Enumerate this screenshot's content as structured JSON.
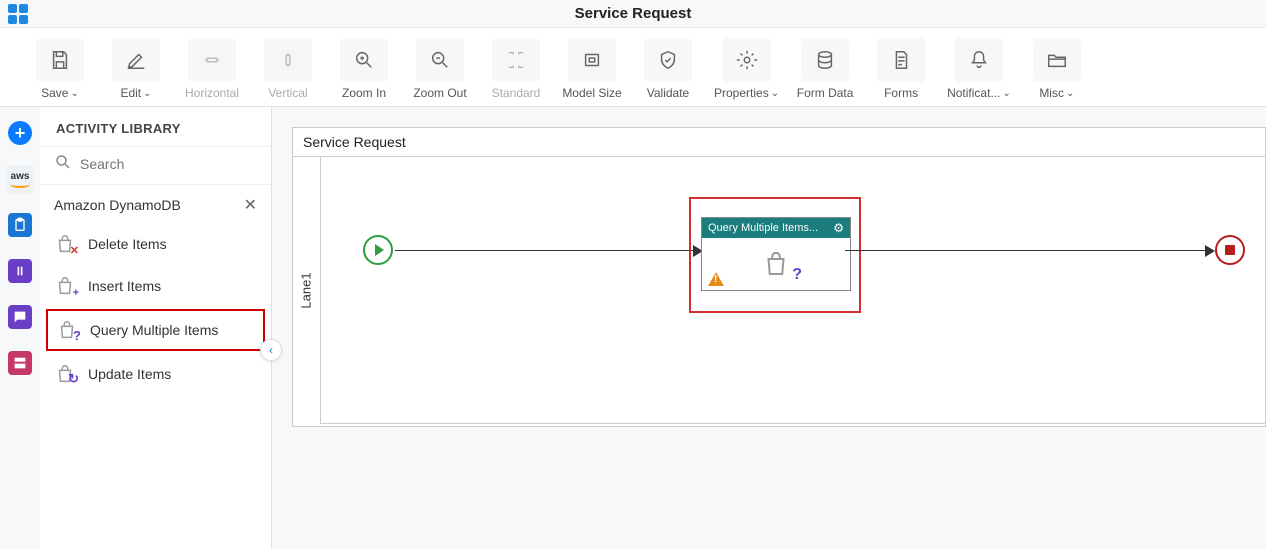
{
  "header": {
    "title": "Service Request"
  },
  "toolbar": {
    "save": "Save",
    "edit": "Edit",
    "horizontal": "Horizontal",
    "vertical": "Vertical",
    "zoom_in": "Zoom In",
    "zoom_out": "Zoom Out",
    "standard": "Standard",
    "model_size": "Model Size",
    "validate": "Validate",
    "properties": "Properties",
    "form_data": "Form Data",
    "forms": "Forms",
    "notifications": "Notificat...",
    "misc": "Misc"
  },
  "sidebar": {
    "title": "ACTIVITY LIBRARY",
    "search_placeholder": "Search",
    "category": "Amazon DynamoDB",
    "items": [
      {
        "label": "Delete Items"
      },
      {
        "label": "Insert Items"
      },
      {
        "label": "Query Multiple Items"
      },
      {
        "label": "Update Items"
      }
    ],
    "selected_index": 2
  },
  "leftbar": {
    "aws_label": "aws"
  },
  "canvas": {
    "title": "Service Request",
    "lane": "Lane1",
    "activity": {
      "title": "Query Multiple Items..."
    }
  }
}
